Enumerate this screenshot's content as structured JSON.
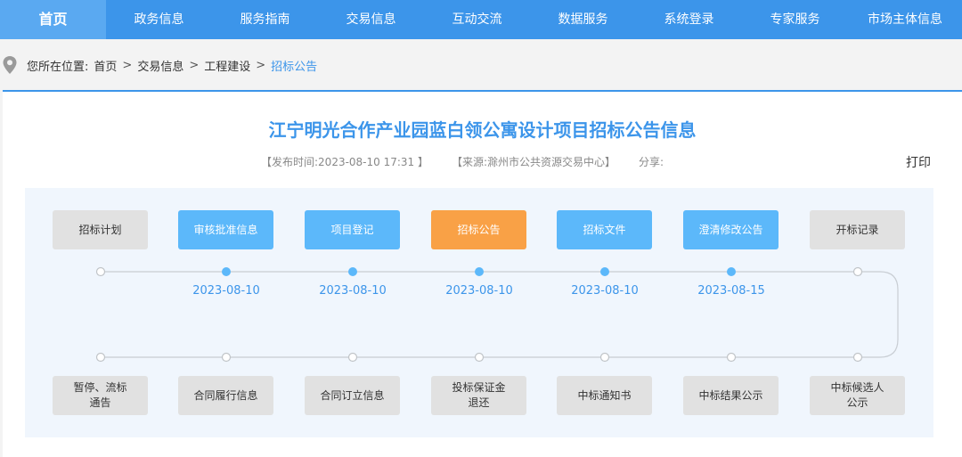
{
  "nav": {
    "items": [
      "首页",
      "政务信息",
      "服务指南",
      "交易信息",
      "互动交流",
      "数据服务",
      "系统登录",
      "专家服务",
      "市场主体信息"
    ]
  },
  "breadcrumb": {
    "prefix": "您所在位置:",
    "items": [
      "首页",
      "交易信息",
      "工程建设",
      "招标公告"
    ],
    "separator": ">"
  },
  "article": {
    "title": "江宁明光合作产业园蓝白领公寓设计项目招标公告信息",
    "publish_time": "【发布时间:2023-08-10 17:31 】",
    "source": "【来源:滁州市公共资源交易中心】",
    "share": "分享:",
    "print": "打印"
  },
  "flow": {
    "top_steps": [
      {
        "label": "招标计划",
        "state": "gray",
        "date": ""
      },
      {
        "label": "审核批准信息",
        "state": "blue",
        "date": "2023-08-10"
      },
      {
        "label": "项目登记",
        "state": "blue",
        "date": "2023-08-10"
      },
      {
        "label": "招标公告",
        "state": "orange",
        "date": "2023-08-10"
      },
      {
        "label": "招标文件",
        "state": "blue",
        "date": "2023-08-10"
      },
      {
        "label": "澄清修改公告",
        "state": "blue",
        "date": "2023-08-15"
      },
      {
        "label": "开标记录",
        "state": "gray",
        "date": ""
      }
    ],
    "bottom_steps": [
      {
        "label": "暂停、流标通告"
      },
      {
        "label": "合同履行信息"
      },
      {
        "label": "合同订立信息"
      },
      {
        "label": "投标保证金退还"
      },
      {
        "label": "中标通知书"
      },
      {
        "label": "中标结果公示"
      },
      {
        "label": "中标候选人公示"
      }
    ],
    "colors": {
      "blue": "#5cb8fa",
      "orange": "#f9a146",
      "gray": "#e1e1e1",
      "accent": "#3c95ea"
    }
  }
}
